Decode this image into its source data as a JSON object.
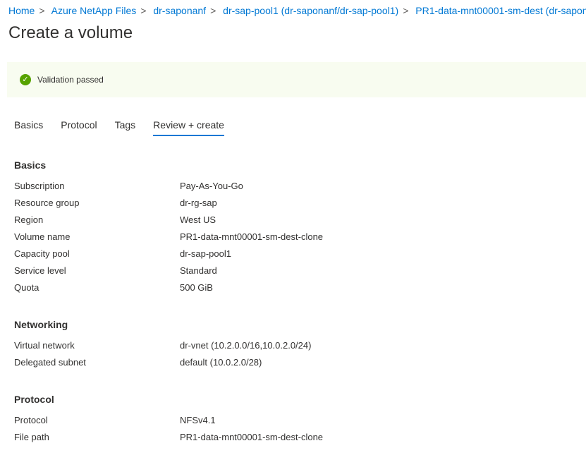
{
  "breadcrumb": [
    "Home",
    "Azure NetApp Files",
    "dr-saponanf",
    "dr-sap-pool1 (dr-saponanf/dr-sap-pool1)",
    "PR1-data-mnt00001-sm-dest (dr-sapon"
  ],
  "title": "Create a volume",
  "validation": {
    "icon": "check-circle-icon",
    "text": "Validation passed",
    "color": "#57a300"
  },
  "tabs": [
    "Basics",
    "Protocol",
    "Tags",
    "Review + create"
  ],
  "sections": [
    {
      "heading": "Basics",
      "rows": [
        [
          "Subscription",
          "Pay-As-You-Go"
        ],
        [
          "Resource group",
          "dr-rg-sap"
        ],
        [
          "Region",
          "West US"
        ],
        [
          "Volume name",
          "PR1-data-mnt00001-sm-dest-clone"
        ],
        [
          "Capacity pool",
          "dr-sap-pool1"
        ],
        [
          "Service level",
          "Standard"
        ],
        [
          "Quota",
          "500 GiB"
        ]
      ]
    },
    {
      "heading": "Networking",
      "rows": [
        [
          "Virtual network",
          "dr-vnet (10.2.0.0/16,10.0.2.0/24)"
        ],
        [
          "Delegated subnet",
          "default (10.0.2.0/28)"
        ]
      ]
    },
    {
      "heading": "Protocol",
      "rows": [
        [
          "Protocol",
          "NFSv4.1"
        ],
        [
          "File path",
          "PR1-data-mnt00001-sm-dest-clone"
        ]
      ]
    }
  ]
}
